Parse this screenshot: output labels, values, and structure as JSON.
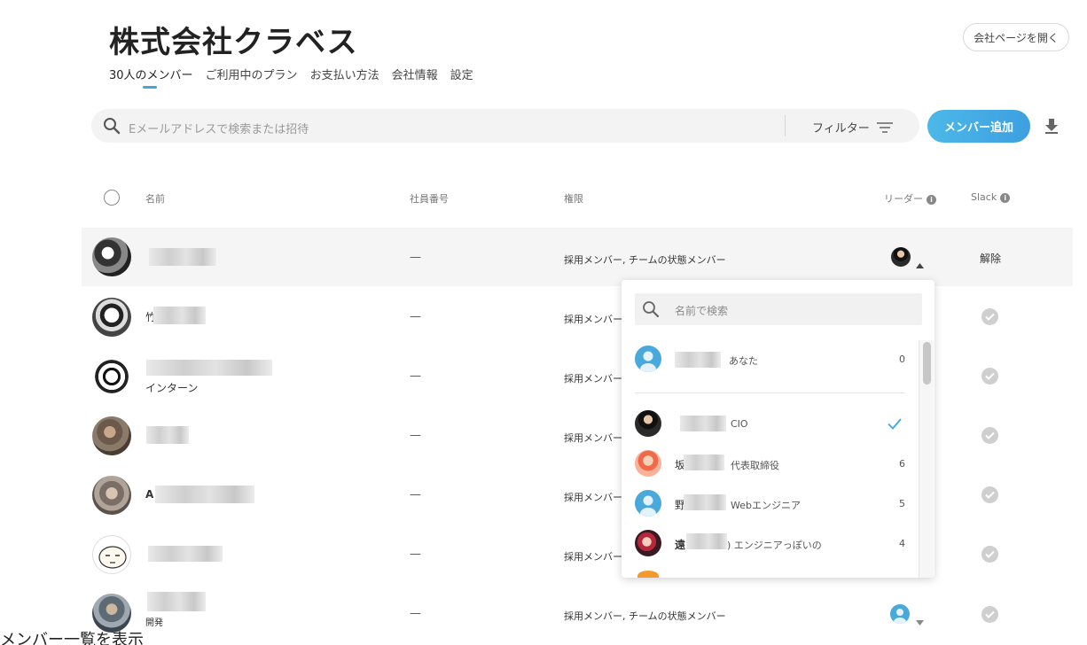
{
  "company": {
    "name": "株式会社クラベス",
    "open_page_label": "会社ページを開く"
  },
  "tabs": [
    "30人のメンバー",
    "ご利用中のプラン",
    "お支払い方法",
    "会社情報",
    "設定"
  ],
  "toolbar": {
    "search_placeholder": "Eメールアドレスで検索または招待",
    "filter_label": "フィルター",
    "add_member_label": "メンバー追加"
  },
  "table": {
    "headers": {
      "name": "名前",
      "employee_no": "社員番号",
      "permission": "権限",
      "leader": "リーダー",
      "slack": "Slack"
    },
    "rows": [
      {
        "name_prefix": "",
        "sub": "",
        "employee_no": "—",
        "permission": "採用メンバー, チームの状態メンバー",
        "slack": "解除"
      },
      {
        "name_prefix": "竹",
        "sub": "",
        "employee_no": "—",
        "permission": "採用メンバー",
        "slack": ""
      },
      {
        "name_prefix": "",
        "sub": "インターン",
        "employee_no": "—",
        "permission": "採用メンバー",
        "slack": ""
      },
      {
        "name_prefix": "",
        "sub": "",
        "employee_no": "—",
        "permission": "採用メンバー",
        "slack": ""
      },
      {
        "name_prefix": "A",
        "sub": "",
        "employee_no": "—",
        "permission": "採用メンバー",
        "slack": ""
      },
      {
        "name_prefix": "",
        "sub": "",
        "employee_no": "—",
        "permission": "採用メンバー",
        "slack": ""
      },
      {
        "name_prefix": "",
        "sub": "開発",
        "employee_no": "—",
        "permission": "採用メンバー, チームの状態メンバー",
        "slack": ""
      }
    ]
  },
  "leader_dropdown": {
    "search_placeholder": "名前で検索",
    "self": {
      "tag": "あなた",
      "count": "0"
    },
    "items": [
      {
        "prefix": "",
        "role": "CIO",
        "count": ""
      },
      {
        "prefix": "坂",
        "role": "代表取締役",
        "count": "6"
      },
      {
        "prefix": "野",
        "role": "Webエンジニア",
        "count": "5"
      },
      {
        "prefix": "遠",
        "role": "エンジニアっぽいの",
        "count": "4"
      }
    ]
  },
  "footer_text": "メンバー一覧を表示",
  "colors": {
    "accent": "#3ea7e2",
    "check": "#3ea7e2",
    "button_gradient_start": "#4cb8e8",
    "button_gradient_end": "#3d9fe0"
  }
}
